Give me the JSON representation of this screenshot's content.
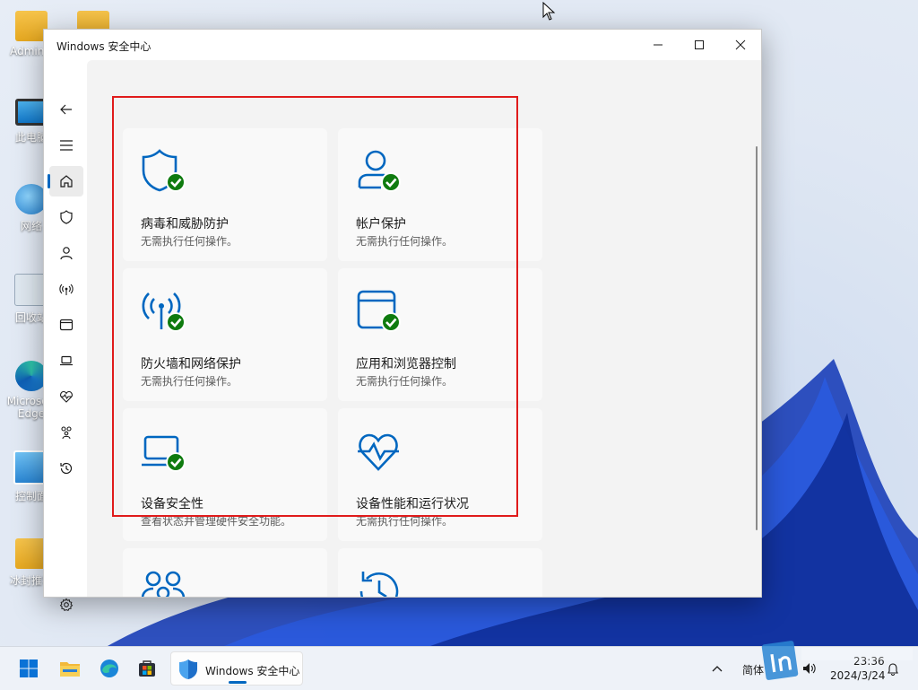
{
  "desktop": {
    "icons": [
      {
        "label": "Adminis",
        "kind": "folder"
      },
      {
        "label": "此电脑",
        "kind": "monitor"
      },
      {
        "label": "网络",
        "kind": "globe"
      },
      {
        "label": "回收站",
        "kind": "recycle"
      },
      {
        "label": "Microsoft Edge",
        "kind": "edge"
      },
      {
        "label": "控制面",
        "kind": "panel"
      },
      {
        "label": "冰封推客",
        "kind": "folder"
      }
    ]
  },
  "window": {
    "title": "Windows 安全中心",
    "controls": {
      "minimize": "minimize-icon",
      "maximize": "maximize-icon",
      "close": "close-icon"
    }
  },
  "nav": {
    "items": [
      {
        "icon": "back-arrow-icon"
      },
      {
        "icon": "hamburger-menu-icon"
      },
      {
        "icon": "home-icon",
        "active": true
      },
      {
        "icon": "shield-icon"
      },
      {
        "icon": "person-icon"
      },
      {
        "icon": "wireless-icon"
      },
      {
        "icon": "browser-window-icon"
      },
      {
        "icon": "laptop-icon"
      },
      {
        "icon": "heart-pulse-icon"
      },
      {
        "icon": "family-icon"
      },
      {
        "icon": "history-icon"
      },
      {
        "icon": "settings-gear-icon"
      }
    ]
  },
  "cards": [
    {
      "name": "病毒和威胁防护",
      "status": "无需执行任何操作。",
      "icon": "shield-check-icon"
    },
    {
      "name": "帐户保护",
      "status": "无需执行任何操作。",
      "icon": "account-check-icon"
    },
    {
      "name": "防火墙和网络保护",
      "status": "无需执行任何操作。",
      "icon": "firewall-check-icon"
    },
    {
      "name": "应用和浏览器控制",
      "status": "无需执行任何操作。",
      "icon": "app-browser-check-icon"
    },
    {
      "name": "设备安全性",
      "status": "查看状态并管理硬件安全功能。",
      "icon": "device-security-check-icon"
    },
    {
      "name": "设备性能和运行状况",
      "status": "无需执行任何操作。",
      "icon": "heart-pulse-icon"
    },
    {
      "name": "",
      "status": "",
      "icon": "family-options-icon"
    },
    {
      "name": "",
      "status": "",
      "icon": "protection-history-icon"
    }
  ],
  "taskbar": {
    "app_label": "Windows 安全中心",
    "ime": "简体",
    "time": "23:36",
    "date": "2024/3/24"
  },
  "colors": {
    "accent": "#0067c0",
    "check": "#0f7b0f",
    "highlight": "#e01b1b"
  }
}
